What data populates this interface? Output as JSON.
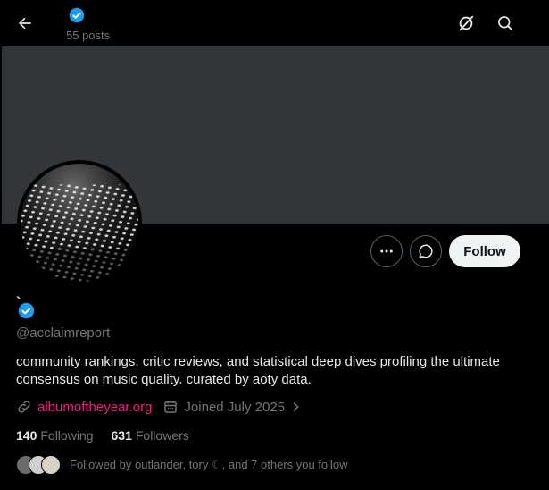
{
  "header": {
    "post_count": "55 posts"
  },
  "profile": {
    "display_name": "`",
    "handle": "@acclaimreport",
    "bio": "community rankings, critic reviews, and statistical deep dives profiling the ultimate consensus on music quality. curated by aoty data.",
    "website": "albumoftheyear.org",
    "joined": "Joined July 2025",
    "following_count": "140",
    "following_label": "Following",
    "followers_count": "631",
    "followers_label": "Followers",
    "followed_by": "Followed by outlander, tory ☾, and 7 others you follow"
  },
  "actions": {
    "follow_label": "Follow"
  },
  "colors": {
    "verified_blue": "#1d9bf0",
    "link_pink": "#f91880",
    "banner": "#333639"
  },
  "icons": [
    "back-arrow-icon",
    "verified-badge-icon",
    "grok-icon",
    "search-icon",
    "more-icon",
    "message-icon",
    "link-icon",
    "calendar-icon",
    "chevron-right-icon"
  ]
}
